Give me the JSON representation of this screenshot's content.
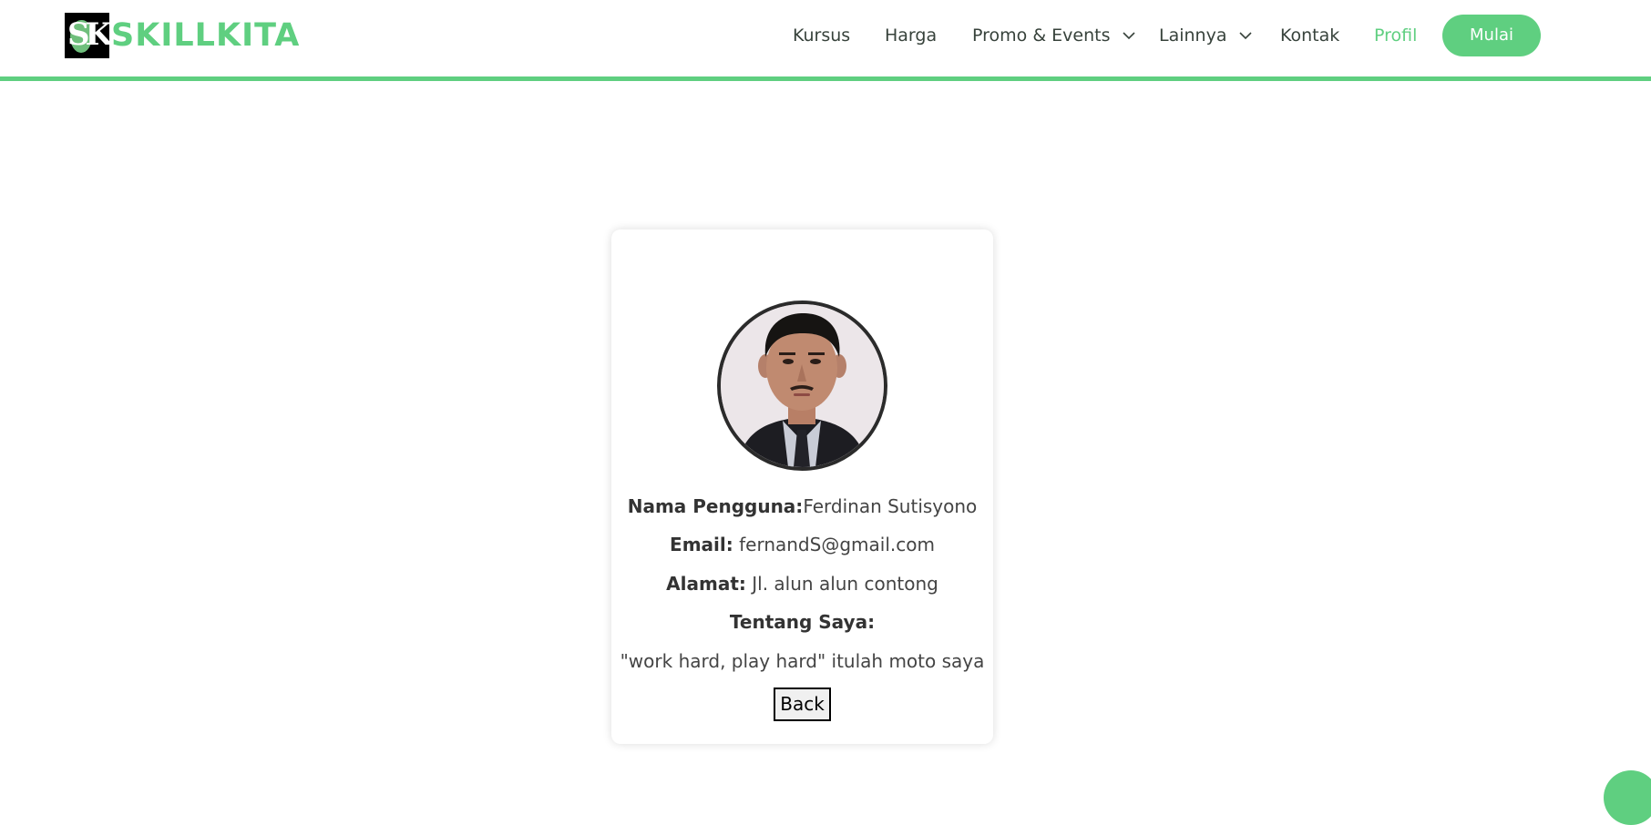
{
  "brand": {
    "name": "SKILLKITA",
    "mark": "SK"
  },
  "nav": {
    "items": [
      {
        "label": "Kursus"
      },
      {
        "label": "Harga"
      },
      {
        "label": "Promo & Events"
      },
      {
        "label": "Lainnya"
      },
      {
        "label": "Kontak"
      },
      {
        "label": "Profil"
      }
    ],
    "cta": "Mulai"
  },
  "profile": {
    "username_label": "Nama Pengguna:",
    "username": "Ferdinan Sutisyono",
    "email_label": "Email:",
    "email": "fernandS@gmail.com",
    "address_label": "Alamat:",
    "address": "Jl. alun alun contong",
    "about_label": "Tentang Saya:",
    "about": "\"work hard, play hard\" itulah moto saya",
    "back_label": "Back"
  },
  "colors": {
    "accent": "#5fcf80",
    "text": "#37423b"
  },
  "icons": {
    "dropdown": "chevron-down-icon",
    "scroll_top": "scroll-top-button"
  }
}
